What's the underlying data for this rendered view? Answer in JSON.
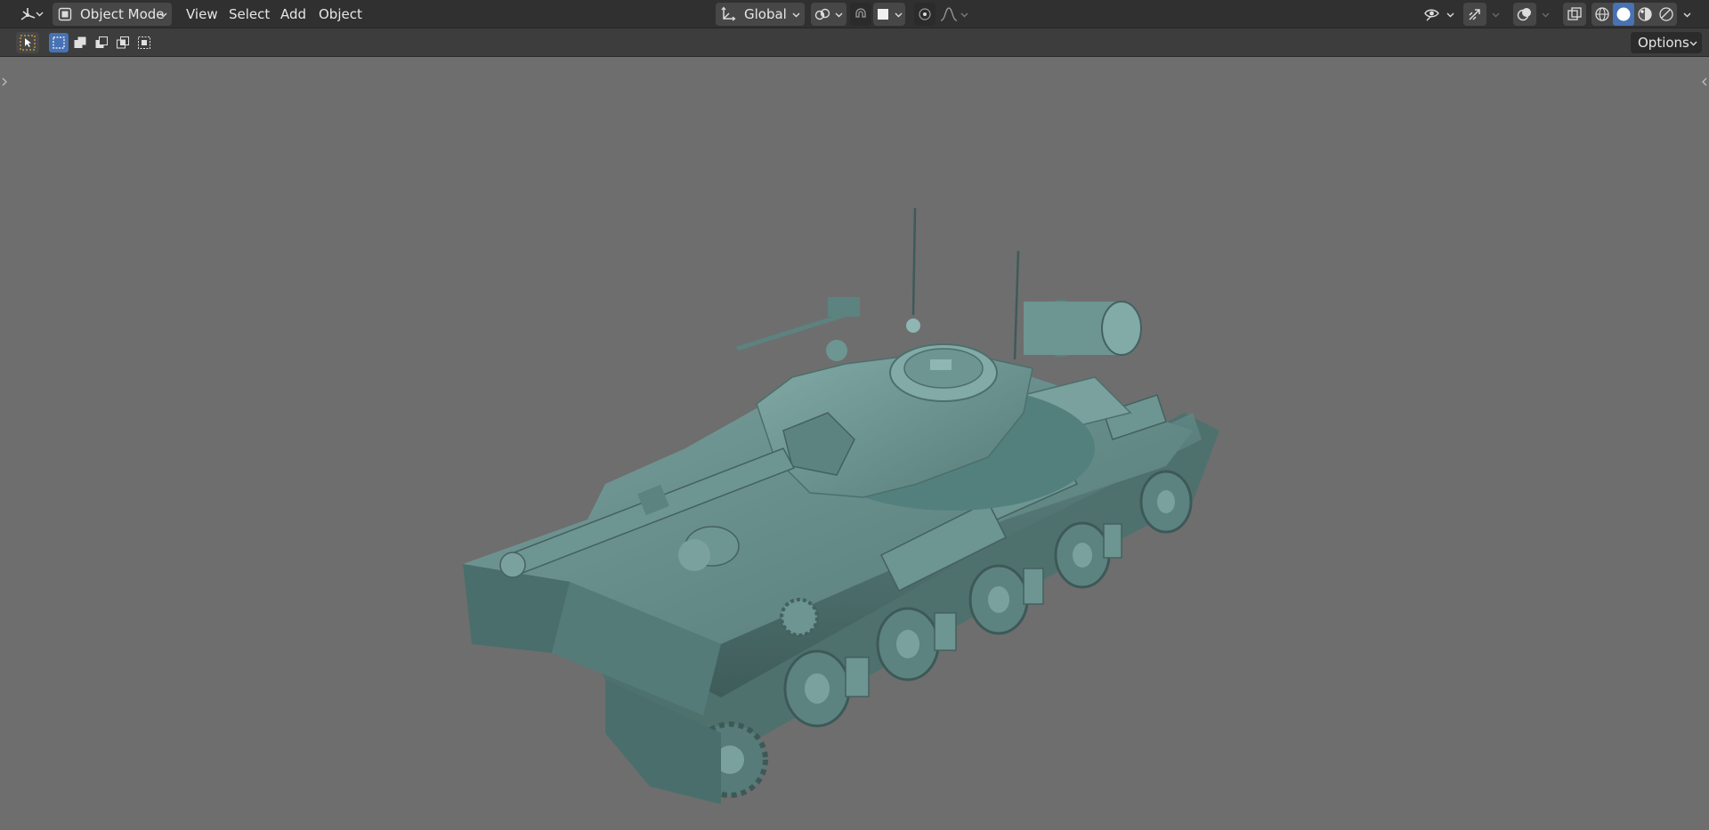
{
  "header": {
    "editor_type_icon": "axis-gizmo-icon",
    "mode": {
      "label": "Object Mode",
      "icon": "object-cube-icon"
    },
    "menus": [
      "View",
      "Select",
      "Add",
      "Object"
    ],
    "transform_orientation": {
      "label": "Global",
      "icon": "orientation-axes-icon"
    },
    "pivot_icon": "pivot-point-icon",
    "snap_icon": "magnet-snap-icon",
    "snap_target_icon": "snap-square-icon",
    "proportional_icon": "proportional-edit-icon",
    "falloff_icon": "falloff-curve-icon",
    "visibility_icon": "eye-visibility-icon",
    "gizmo_icon": "gizmo-arrow-icon",
    "overlay_icon": "overlays-circles-icon",
    "xray_icon": "xray-toggle-icon",
    "shading_modes": [
      {
        "name": "wireframe",
        "icon": "wireframe-sphere-icon",
        "active": false
      },
      {
        "name": "solid",
        "icon": "solid-sphere-icon",
        "active": true
      },
      {
        "name": "material",
        "icon": "material-sphere-icon",
        "active": false
      },
      {
        "name": "rendered",
        "icon": "rendered-sphere-icon",
        "active": false
      }
    ]
  },
  "tool_header": {
    "active_tool_icon": "select-box-cursor-icon",
    "selection_modes": [
      {
        "name": "set",
        "icon": "select-new-icon",
        "active": true
      },
      {
        "name": "extend",
        "icon": "select-extend-icon",
        "active": false
      },
      {
        "name": "subtract",
        "icon": "select-subtract-icon",
        "active": false
      },
      {
        "name": "intersect",
        "icon": "select-intersect-icon",
        "active": false
      },
      {
        "name": "invert",
        "icon": "select-invert-icon",
        "active": false
      }
    ],
    "options_label": "Options"
  },
  "viewport": {
    "background": "#6e6e6e",
    "model_color": "#5f8582",
    "model_icon": "tank-model-icon"
  },
  "colors": {
    "accent": "#4772b3",
    "header_bg": "#303030",
    "tool_header_bg": "#3d3d3d"
  }
}
